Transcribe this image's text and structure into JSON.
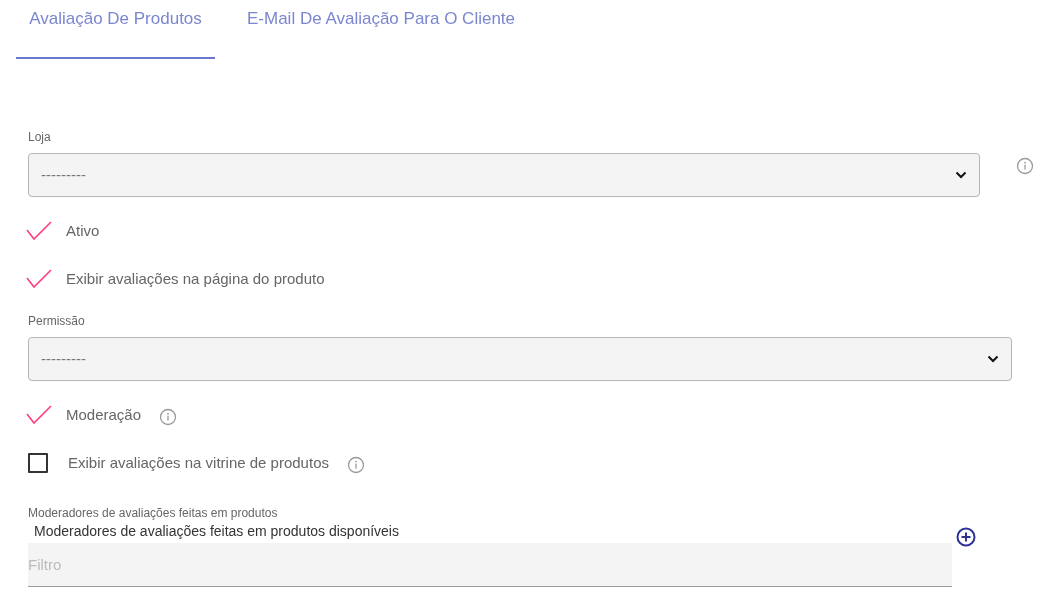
{
  "tabs": [
    {
      "label": "Avaliação De Produtos",
      "selected": true
    },
    {
      "label": "E-Mail De Avaliação Para O Cliente",
      "selected": false
    }
  ],
  "form": [
    {
      "kind": "select",
      "label": "Loja",
      "value": "---------",
      "info": true
    },
    {
      "kind": "checkbox",
      "label": "Ativo",
      "checked": true,
      "info": false
    },
    {
      "kind": "checkbox",
      "label": "Exibir avaliações na página do produto",
      "checked": true,
      "info": false
    },
    {
      "kind": "select",
      "label": "Permissão",
      "value": "---------",
      "info": false
    },
    {
      "kind": "checkbox",
      "label": "Moderação",
      "checked": true,
      "info": true
    },
    {
      "kind": "checkbox",
      "label": "Exibir avaliações na vitrine de produtos",
      "checked": false,
      "info": true
    },
    {
      "kind": "multiselect",
      "label": "Moderadores de avaliações feitas em produtos",
      "subtitle": "Moderadores de avaliações feitas em produtos disponíveis",
      "placeholder": "Filtro"
    }
  ]
}
